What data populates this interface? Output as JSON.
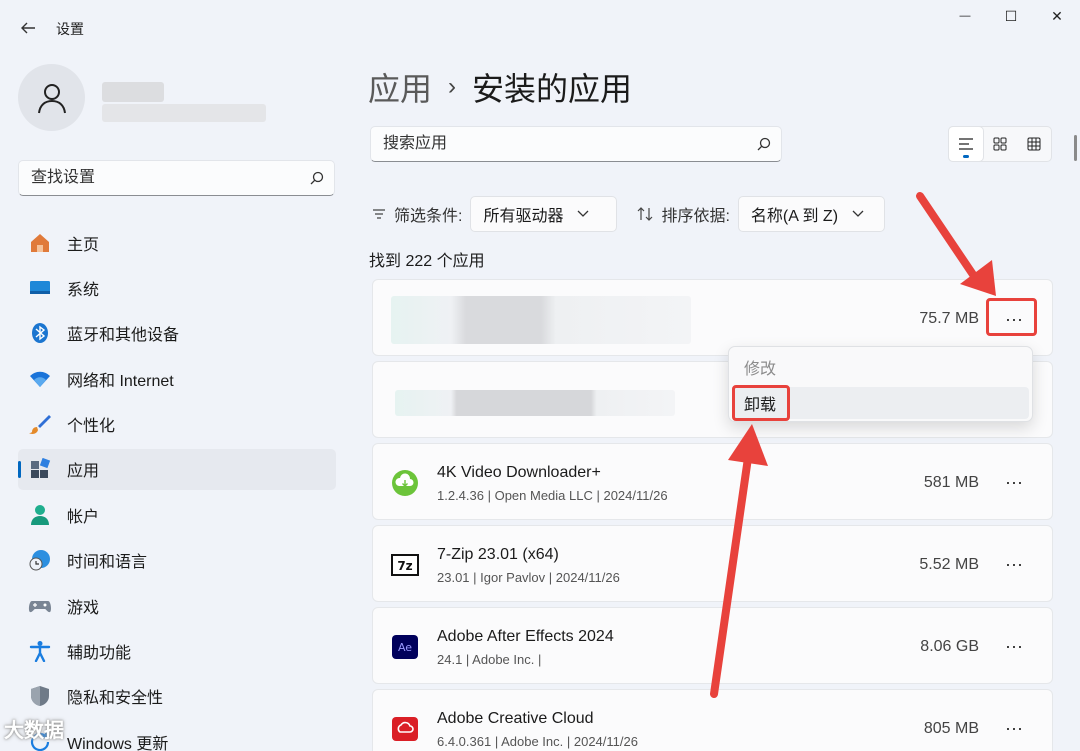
{
  "window": {
    "title": "设置",
    "back_icon": "back-arrow-icon",
    "minimize_glyph": "—",
    "maximize_glyph": "☐",
    "close_glyph": "✕"
  },
  "sidebar": {
    "search": {
      "placeholder": "查找设置",
      "value": ""
    },
    "items": [
      {
        "label": "主页",
        "icon": "home-icon",
        "active": false
      },
      {
        "label": "系统",
        "icon": "system-icon",
        "active": false
      },
      {
        "label": "蓝牙和其他设备",
        "icon": "bluetooth-icon",
        "active": false
      },
      {
        "label": "网络和 Internet",
        "icon": "wifi-icon",
        "active": false
      },
      {
        "label": "个性化",
        "icon": "brush-icon",
        "active": false
      },
      {
        "label": "应用",
        "icon": "apps-icon",
        "active": true
      },
      {
        "label": "帐户",
        "icon": "account-icon",
        "active": false
      },
      {
        "label": "时间和语言",
        "icon": "globe-clock-icon",
        "active": false
      },
      {
        "label": "游戏",
        "icon": "gamepad-icon",
        "active": false
      },
      {
        "label": "辅助功能",
        "icon": "accessibility-icon",
        "active": false
      },
      {
        "label": "隐私和安全性",
        "icon": "shield-icon",
        "active": false
      },
      {
        "label": "Windows 更新",
        "icon": "update-icon",
        "active": false
      }
    ]
  },
  "main": {
    "breadcrumb": {
      "parent": "应用",
      "separator": "›",
      "current": "安装的应用"
    },
    "search": {
      "placeholder": "搜索应用",
      "value": ""
    },
    "filter": {
      "label": "筛选条件:",
      "value": "所有驱动器"
    },
    "sort": {
      "label": "排序依据:",
      "value": "名称(A 到 Z)"
    },
    "count_text": "找到 222 个应用",
    "apps": [
      {
        "name": "",
        "meta": "",
        "size": "75.7 MB",
        "icon": "blurred-app-icon",
        "blurred": true
      },
      {
        "name": "",
        "meta": "",
        "size": "",
        "icon": "blurred-app-icon",
        "blurred": true
      },
      {
        "name": "4K Video Downloader+",
        "meta": "1.2.4.36  |  Open Media LLC  |  2024/11/26",
        "size": "581 MB",
        "icon": "cloud-download-icon"
      },
      {
        "name": "7-Zip 23.01 (x64)",
        "meta": "23.01  |  Igor Pavlov  |  2024/11/26",
        "size": "5.52 MB",
        "icon": "7zip-icon"
      },
      {
        "name": "Adobe After Effects 2024",
        "meta": "24.1  |  Adobe Inc.  |",
        "size": "8.06 GB",
        "icon": "after-effects-icon"
      },
      {
        "name": "Adobe Creative Cloud",
        "meta": "6.4.0.361  |  Adobe Inc.  |  2024/11/26",
        "size": "805 MB",
        "icon": "creative-cloud-icon"
      }
    ],
    "more_glyph": "···",
    "context_menu": {
      "modify": "修改",
      "uninstall": "卸载"
    }
  },
  "watermark": "大数据",
  "colors": {
    "accent": "#0067c0",
    "annotation_red": "#e8423c"
  }
}
